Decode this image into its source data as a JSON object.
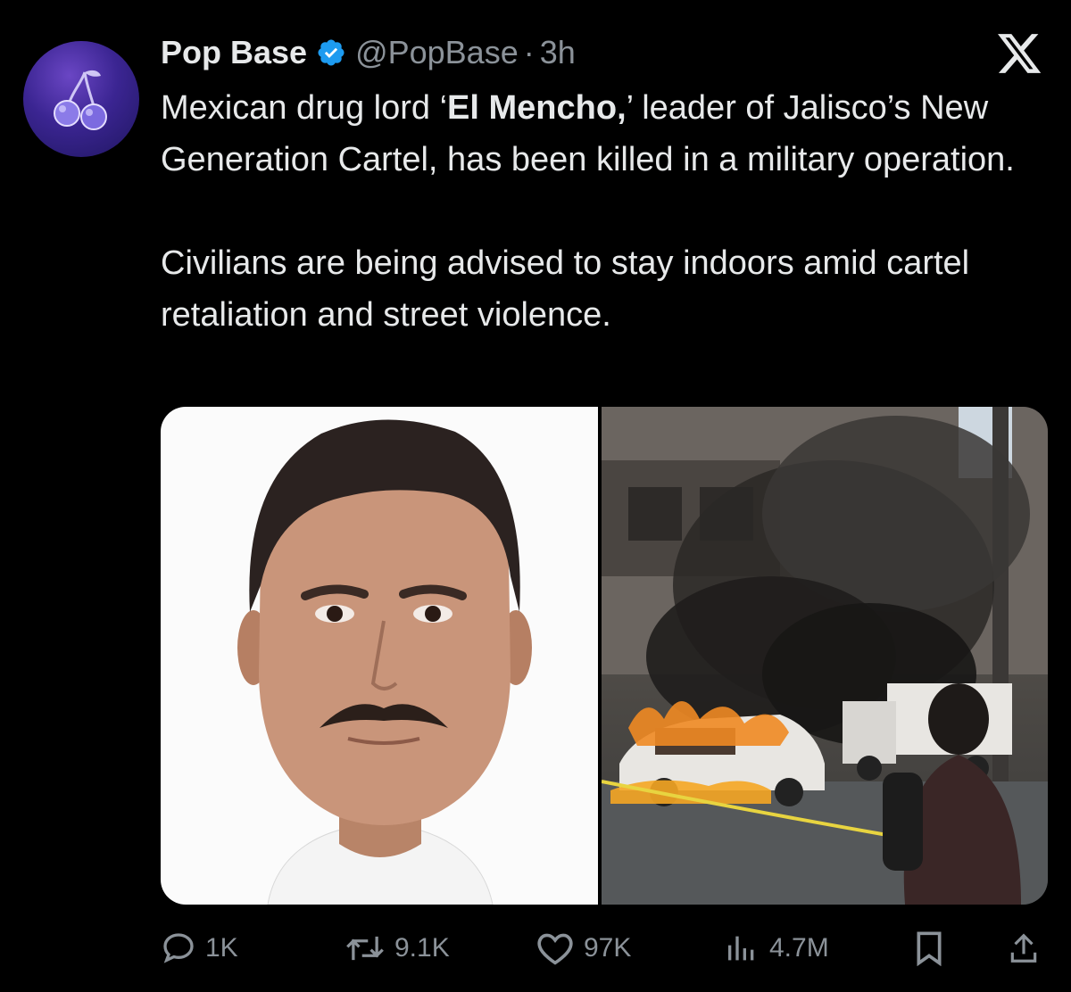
{
  "account": {
    "name": "Pop Base",
    "handle": "@PopBase",
    "separator": "·",
    "time": "3h",
    "avatar_icon": "cherries-icon",
    "verified_icon": "verified-badge-icon",
    "verified_color": "#1d9bf0"
  },
  "platform_icon": "x-logo-icon",
  "tweet": {
    "p1_before": "Mexican drug lord ‘",
    "p1_bold": "El Mencho,",
    "p1_after": "’ leader of Jalisco’s New Generation Cartel, has been killed in a military operation.",
    "p2": "Civilians are being advised to stay indoors amid cartel retaliation and street violence."
  },
  "media": {
    "left_image": "mugshot-photo",
    "right_image": "burning-car-street-photo"
  },
  "actions": {
    "reply_count": "1K",
    "repost_count": "9.1K",
    "like_count": "97K",
    "views_count": "4.7M",
    "reply_icon": "reply-icon",
    "repost_icon": "repost-icon",
    "like_icon": "heart-icon",
    "views_icon": "views-icon",
    "bookmark_icon": "bookmark-icon",
    "share_icon": "share-icon"
  },
  "colors": {
    "background": "#000000",
    "text": "#e7e9ea",
    "secondary": "#8b9299"
  }
}
